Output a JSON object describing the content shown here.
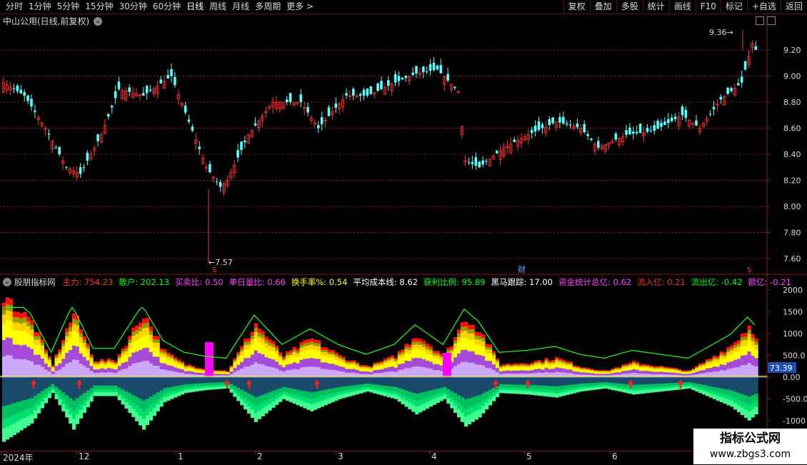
{
  "toolbar": {
    "periods": [
      "分时",
      "1分钟",
      "5分钟",
      "15分钟",
      "30分钟",
      "60分钟",
      "日线",
      "周线",
      "月线",
      "多周期",
      "更多 >"
    ],
    "active_period": "日线",
    "right": [
      "复权",
      "叠加",
      "多股",
      "统计",
      "画线",
      "F10",
      "标记",
      "+自选",
      "返回"
    ]
  },
  "stock_title": "中山公用(日线,前复权)",
  "price_axis": [
    "9.20",
    "9.00",
    "8.80",
    "8.60",
    "8.40",
    "8.20",
    "8.00",
    "7.80",
    "7.60"
  ],
  "annotations": {
    "high_label": "9.36",
    "low_label": "7.57",
    "finance_marker": "财",
    "s_marker": "S"
  },
  "indicator": {
    "name": "股朋指标网",
    "items": [
      {
        "label": "主力: 754.23",
        "color": "#ff3030"
      },
      {
        "label": "散户: 202.13",
        "color": "#00ff00"
      },
      {
        "label": "买卖比: 0.50",
        "color": "#ff40ff"
      },
      {
        "label": "单日量比: 0.66",
        "color": "#ff40ff"
      },
      {
        "label": "换手率%: 0.54",
        "color": "#ffff00"
      },
      {
        "label": "平均成本线: 8.62",
        "color": "#ffffff"
      },
      {
        "label": "获利比例: 95.89",
        "color": "#00ff00"
      },
      {
        "label": "黑马跟踪: 17.00",
        "color": "#ffffff"
      },
      {
        "label": "资金统计总亿: 0.62",
        "color": "#ff40ff"
      },
      {
        "label": "流入亿: 0.21",
        "color": "#ff3030"
      },
      {
        "label": "流出亿: -0.42",
        "color": "#00ff00"
      },
      {
        "label": "额亿: -0.21",
        "color": "#ff40ff"
      }
    ],
    "axis": [
      "2000",
      "1500",
      "1000",
      "500.0",
      "0.00",
      "-500.0",
      "-1000"
    ],
    "current_value": "73.39"
  },
  "date_axis": [
    "2024年",
    "12",
    "1",
    "2",
    "3",
    "4",
    "5",
    "6"
  ],
  "watermark": {
    "title": "指标公式网",
    "url": "www.zbgs3.com"
  },
  "colors": {
    "up": "#ff3030",
    "down": "#54ffff",
    "grid": "#8b1a1a"
  }
}
